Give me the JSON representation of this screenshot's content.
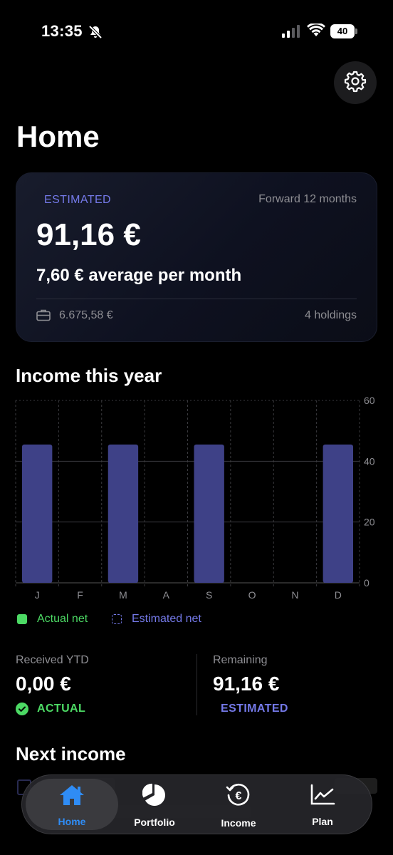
{
  "status_bar": {
    "time": "13:35",
    "battery": "40"
  },
  "page": {
    "title": "Home"
  },
  "summary_card": {
    "label": "ESTIMATED",
    "period": "Forward 12 months",
    "amount": "91,16 €",
    "average": "7,60 € average per month",
    "portfolio_value": "6.675,58 €",
    "holdings": "4 holdings"
  },
  "income_section": {
    "title": "Income this year"
  },
  "chart_data": {
    "type": "bar",
    "categories": [
      "J",
      "F",
      "M",
      "A",
      "S",
      "O",
      "N",
      "D"
    ],
    "series": [
      {
        "name": "Estimated net",
        "values": [
          45.5,
          0,
          45.5,
          0,
          45.5,
          0,
          0,
          45.5
        ]
      }
    ],
    "ylim": [
      0,
      60
    ],
    "yticks": [
      0,
      20,
      40,
      60
    ],
    "legend": [
      "Actual net",
      "Estimated net"
    ],
    "grid": true,
    "colors": {
      "estimated": "#3e4187",
      "actual": "#4cd964"
    }
  },
  "legend": {
    "actual": "Actual net",
    "estimated": "Estimated net"
  },
  "stats": {
    "received_label": "Received YTD",
    "received_value": "0,00 €",
    "received_badge": "ACTUAL",
    "remaining_label": "Remaining",
    "remaining_value": "91,16 €",
    "remaining_badge": "ESTIMATED"
  },
  "next_income": {
    "title": "Next income"
  },
  "nav": {
    "items": [
      {
        "label": "Home",
        "icon": "house-icon",
        "active": true
      },
      {
        "label": "Portfolio",
        "icon": "pie-chart-icon",
        "active": false
      },
      {
        "label": "Income",
        "icon": "euro-cycle-icon",
        "active": false
      },
      {
        "label": "Plan",
        "icon": "line-chart-icon",
        "active": false
      }
    ]
  },
  "colors": {
    "accent": "#7479e8",
    "positive": "#4cd964",
    "nav_active": "#2f8cf5"
  }
}
